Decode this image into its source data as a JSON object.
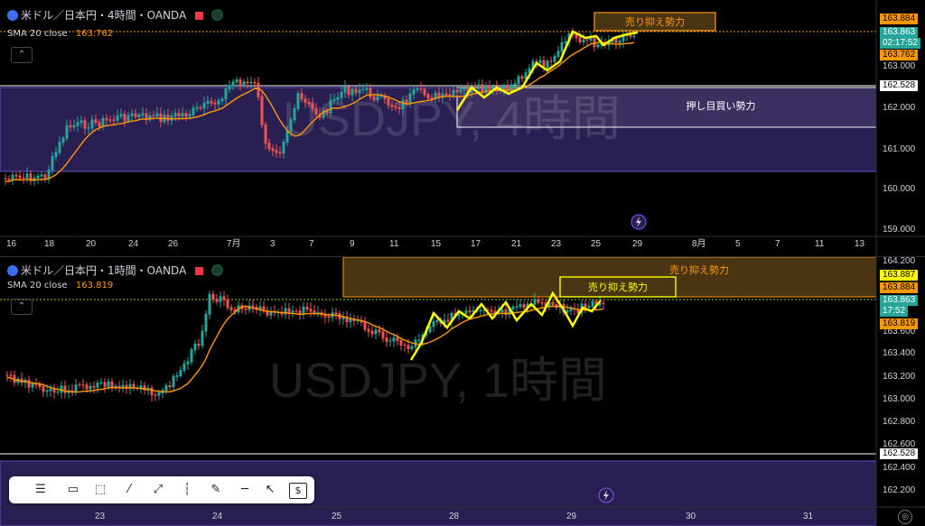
{
  "top": {
    "legend_symbol": "米ドル／日本円・4時間・OANDA",
    "sma_label": "SMA 20 close",
    "sma_value": "163.762",
    "watermark": "USDJPY, 4時間",
    "zone_sell_label": "売り抑え勢力",
    "zone_buy_label": "押し目買い勢力",
    "price_ticks": [
      "163.000",
      "162.000",
      "161.000",
      "160.000",
      "159.000"
    ],
    "price_tags": {
      "p1": "163.884",
      "p2": "163.863",
      "countdown": "02:17:52",
      "sma": "163.762",
      "level": "162.528"
    },
    "date_ticks": [
      "16",
      "18",
      "20",
      "24",
      "26",
      "7月",
      "3",
      "7",
      "9",
      "11",
      "15",
      "17",
      "21",
      "23",
      "25",
      "29",
      "8月",
      "5",
      "7",
      "11",
      "13"
    ]
  },
  "bottom": {
    "legend_symbol": "米ドル／日本円・1時間・OANDA",
    "sma_label": "SMA 20 close",
    "sma_value": "163.819",
    "watermark": "USDJPY, 1時間",
    "zone_sell_label": "売り抑え勢力",
    "zone_sell_label2": "売り抑え勢力",
    "price_ticks": [
      "164.200",
      "163.600",
      "163.400",
      "163.200",
      "163.000",
      "162.800",
      "162.600",
      "162.400",
      "162.200"
    ],
    "price_tags": {
      "p1": "163.887",
      "p2": "163.884",
      "p3": "163.863",
      "countdown": "17:52",
      "sma": "163.819",
      "level": "162.528"
    },
    "date_ticks": [
      "23",
      "24",
      "25",
      "28",
      "29",
      "30",
      "31"
    ]
  },
  "colors": {
    "up": "#26a69a",
    "down": "#ef5350",
    "sma": "#ff9800",
    "zone_buy": "#2a1f52",
    "zone_sell": "#4a3512",
    "highlight": "#ffff00",
    "accent_orange": "#ff9800"
  },
  "toolbar_icons": [
    "lines-menu-icon",
    "comment-icon",
    "rectangle-icon",
    "trendline-icon",
    "path-icon",
    "vertical-line-icon",
    "pen-icon",
    "horizontal-ray-icon",
    "cursor-icon",
    "price-tag-icon"
  ]
}
